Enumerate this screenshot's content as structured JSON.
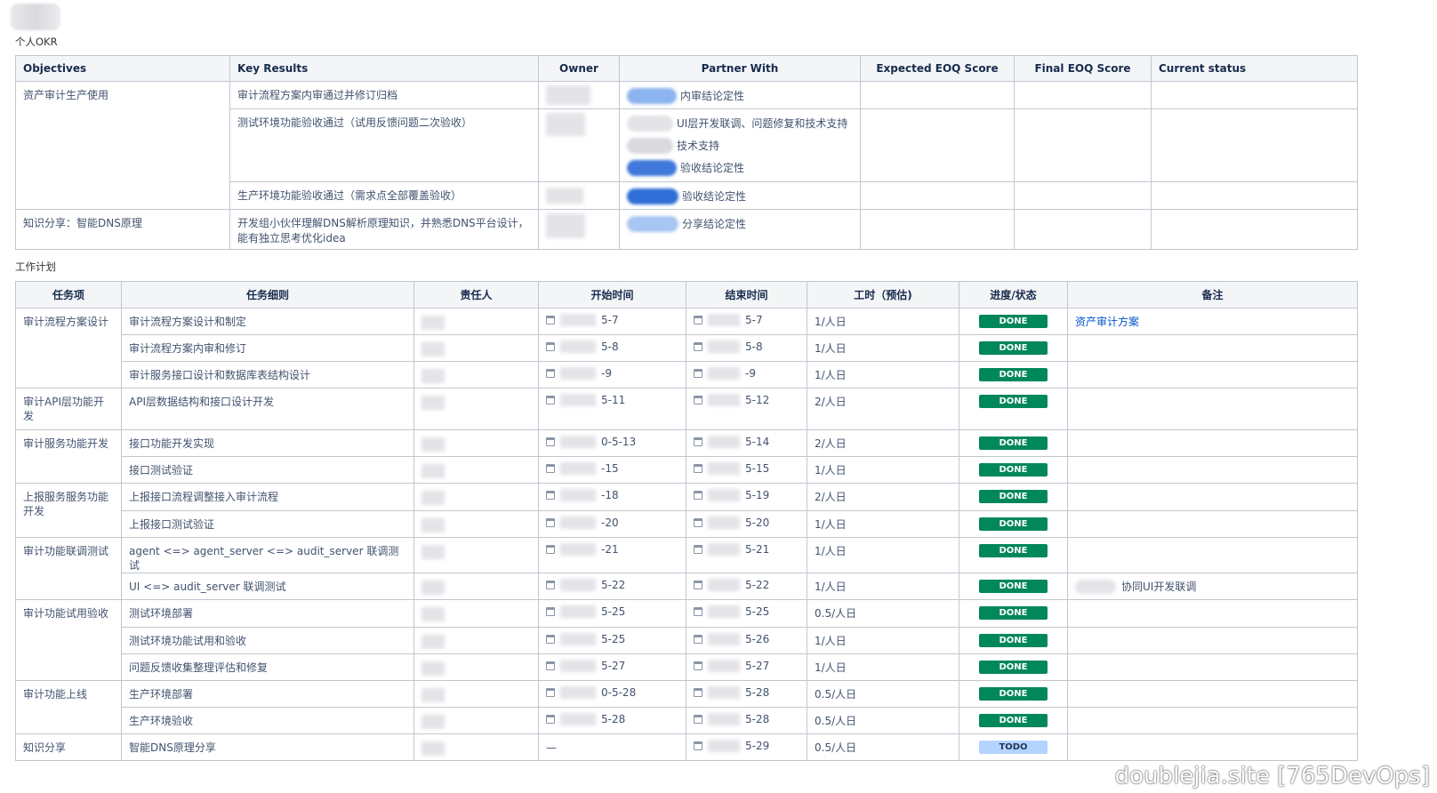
{
  "okr": {
    "title": "个人OKR",
    "headers": [
      "Objectives",
      "Key Results",
      "Owner",
      "Partner With",
      "Expected EOQ Score",
      "Final EOQ Score",
      "Current status"
    ],
    "rows": [
      {
        "objective": "资产审计生产使用",
        "kr": "审计流程方案内审通过并修订归档",
        "partners": [
          "内审结论定性"
        ]
      },
      {
        "objective": "",
        "kr": "测试环境功能验收通过（试用反馈问题二次验收）",
        "partners": [
          "UI层开发联调、问题修复和技术支持",
          "技术支持",
          "验收结论定性"
        ]
      },
      {
        "objective": "",
        "kr": "生产环境功能验收通过（需求点全部覆盖验收）",
        "partners": [
          "验收结论定性"
        ]
      },
      {
        "objective": "知识分享：智能DNS原理",
        "kr": "开发组小伙伴理解DNS解析原理知识，并熟悉DNS平台设计，能有独立思考优化idea",
        "partners": [
          "分享结论定性"
        ]
      }
    ]
  },
  "plan": {
    "title": "工作计划",
    "headers": [
      "任务项",
      "任务细则",
      "责任人",
      "开始时间",
      "结束时间",
      "工时（预估)",
      "进度/状态",
      "备注"
    ],
    "rows": [
      {
        "item": "审计流程方案设计",
        "detail": "审计流程方案设计和制定",
        "start": "5-7",
        "end": "5-7",
        "hours": "1/人日",
        "status": "DONE",
        "note": "资产审计方案"
      },
      {
        "item": "",
        "detail": "审计流程方案内审和修订",
        "start": "5-8",
        "end": "5-8",
        "hours": "1/人日",
        "status": "DONE",
        "note": ""
      },
      {
        "item": "",
        "detail": "审计服务接口设计和数据库表结构设计",
        "start": "-9",
        "end": "-9",
        "hours": "1/人日",
        "status": "DONE",
        "note": ""
      },
      {
        "item": "审计API层功能开发",
        "detail": "API层数据结构和接口设计开发",
        "start": "5-11",
        "end": "5-12",
        "hours": "2/人日",
        "status": "DONE",
        "note": ""
      },
      {
        "item": "审计服务功能开发",
        "detail": "接口功能开发实现",
        "start": "0-5-13",
        "end": "5-14",
        "hours": "2/人日",
        "status": "DONE",
        "note": ""
      },
      {
        "item": "",
        "detail": "接口测试验证",
        "start": "-15",
        "end": "5-15",
        "hours": "1/人日",
        "status": "DONE",
        "note": ""
      },
      {
        "item": "上报服务服务功能开发",
        "detail": "上报接口流程调整接入审计流程",
        "start": "-18",
        "end": "5-19",
        "hours": "2/人日",
        "status": "DONE",
        "note": ""
      },
      {
        "item": "",
        "detail": "上报接口测试验证",
        "start": "-20",
        "end": "5-20",
        "hours": "1/人日",
        "status": "DONE",
        "note": ""
      },
      {
        "item": "审计功能联调测试",
        "detail": "agent <=> agent_server <=> audit_server 联调测试",
        "start": "-21",
        "end": "5-21",
        "hours": "1/人日",
        "status": "DONE",
        "note": ""
      },
      {
        "item": "",
        "detail": "UI <=> audit_server 联调测试",
        "start": "5-22",
        "end": "5-22",
        "hours": "1/人日",
        "status": "DONE",
        "note": "协同UI开发联调"
      },
      {
        "item": "审计功能试用验收",
        "detail": "测试环境部署",
        "start": "5-25",
        "end": "5-25",
        "hours": "0.5/人日",
        "status": "DONE",
        "note": ""
      },
      {
        "item": "",
        "detail": "测试环境功能试用和验收",
        "start": "5-25",
        "end": "5-26",
        "hours": "1/人日",
        "status": "DONE",
        "note": ""
      },
      {
        "item": "",
        "detail": "问题反馈收集整理评估和修复",
        "start": "5-27",
        "end": "5-27",
        "hours": "1/人日",
        "status": "DONE",
        "note": ""
      },
      {
        "item": "审计功能上线",
        "detail": "生产环境部署",
        "start": "0-5-28",
        "end": "5-28",
        "hours": "0.5/人日",
        "status": "DONE",
        "note": ""
      },
      {
        "item": "",
        "detail": "生产环境验收",
        "start": "5-28",
        "end": "5-28",
        "hours": "0.5/人日",
        "status": "DONE",
        "note": ""
      },
      {
        "item": "知识分享",
        "detail": "智能DNS原理分享",
        "start": "—",
        "end": "5-29",
        "hours": "0.5/人日",
        "status": "TODO",
        "note": ""
      }
    ]
  },
  "watermark": "doublejia.site [765DevOps]"
}
